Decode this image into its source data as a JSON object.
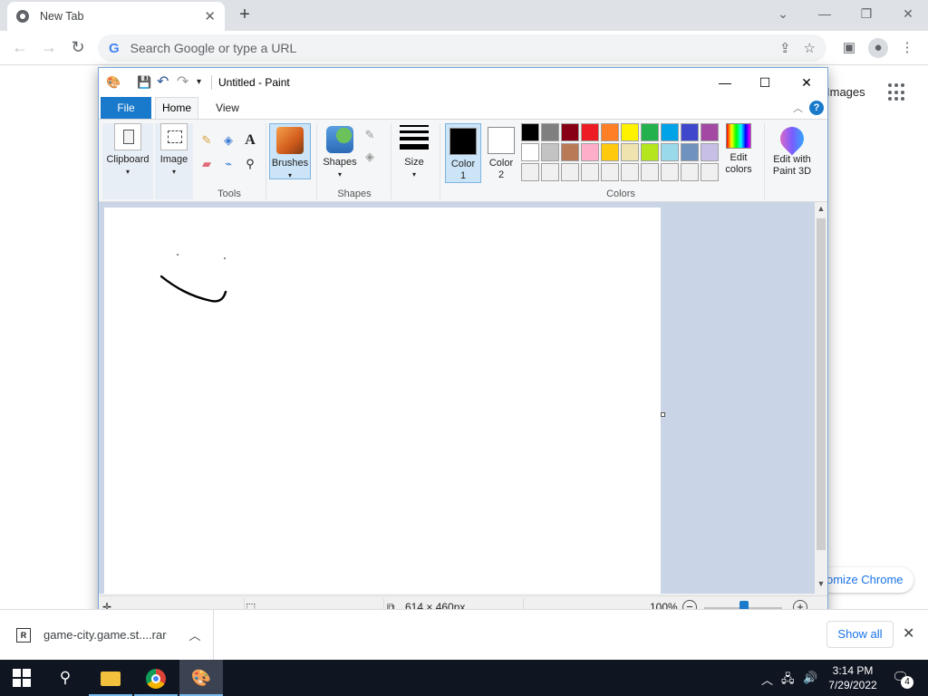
{
  "chrome": {
    "tab_title": "New Tab",
    "omnibox_placeholder": "Search Google or type a URL",
    "ntp_images": "Images",
    "customize_label": "omize Chrome"
  },
  "paint": {
    "title": "Untitled - Paint",
    "tabs": {
      "file": "File",
      "home": "Home",
      "view": "View"
    },
    "groups": {
      "clipboard": "Clipboard",
      "image": "Image",
      "tools": "Tools",
      "brushes": "Brushes",
      "shapes_btn": "Shapes",
      "shapes_group": "Shapes",
      "size": "Size",
      "color1": "Color\n1",
      "color2": "Color\n2",
      "colors": "Colors",
      "edit_colors": "Edit\ncolors",
      "paint3d": "Edit with\nPaint 3D"
    },
    "color1_value": "#000000",
    "color2_value": "#ffffff",
    "palette_row1": [
      "#000000",
      "#7f7f7f",
      "#880015",
      "#ed1c24",
      "#ff7f27",
      "#fff200",
      "#22b14c",
      "#00a2e8",
      "#3f48cc",
      "#a349a4"
    ],
    "palette_row2": [
      "#ffffff",
      "#c3c3c3",
      "#b97a57",
      "#ffaec9",
      "#ffc90e",
      "#efe4b0",
      "#b5e61d",
      "#99d9ea",
      "#7092be",
      "#c8bfe7"
    ],
    "palette_row3": [
      "#f0f0f0",
      "#f0f0f0",
      "#f0f0f0",
      "#f0f0f0",
      "#f0f0f0",
      "#f0f0f0",
      "#f0f0f0",
      "#f0f0f0",
      "#f0f0f0",
      "#f0f0f0"
    ],
    "status": {
      "image_size": "614 × 460px",
      "zoom": "100%"
    }
  },
  "downloads": {
    "file_name": "game-city.game.st....rar",
    "show_all": "Show all"
  },
  "taskbar": {
    "time": "3:14 PM",
    "date": "7/29/2022",
    "notification_count": "4"
  }
}
